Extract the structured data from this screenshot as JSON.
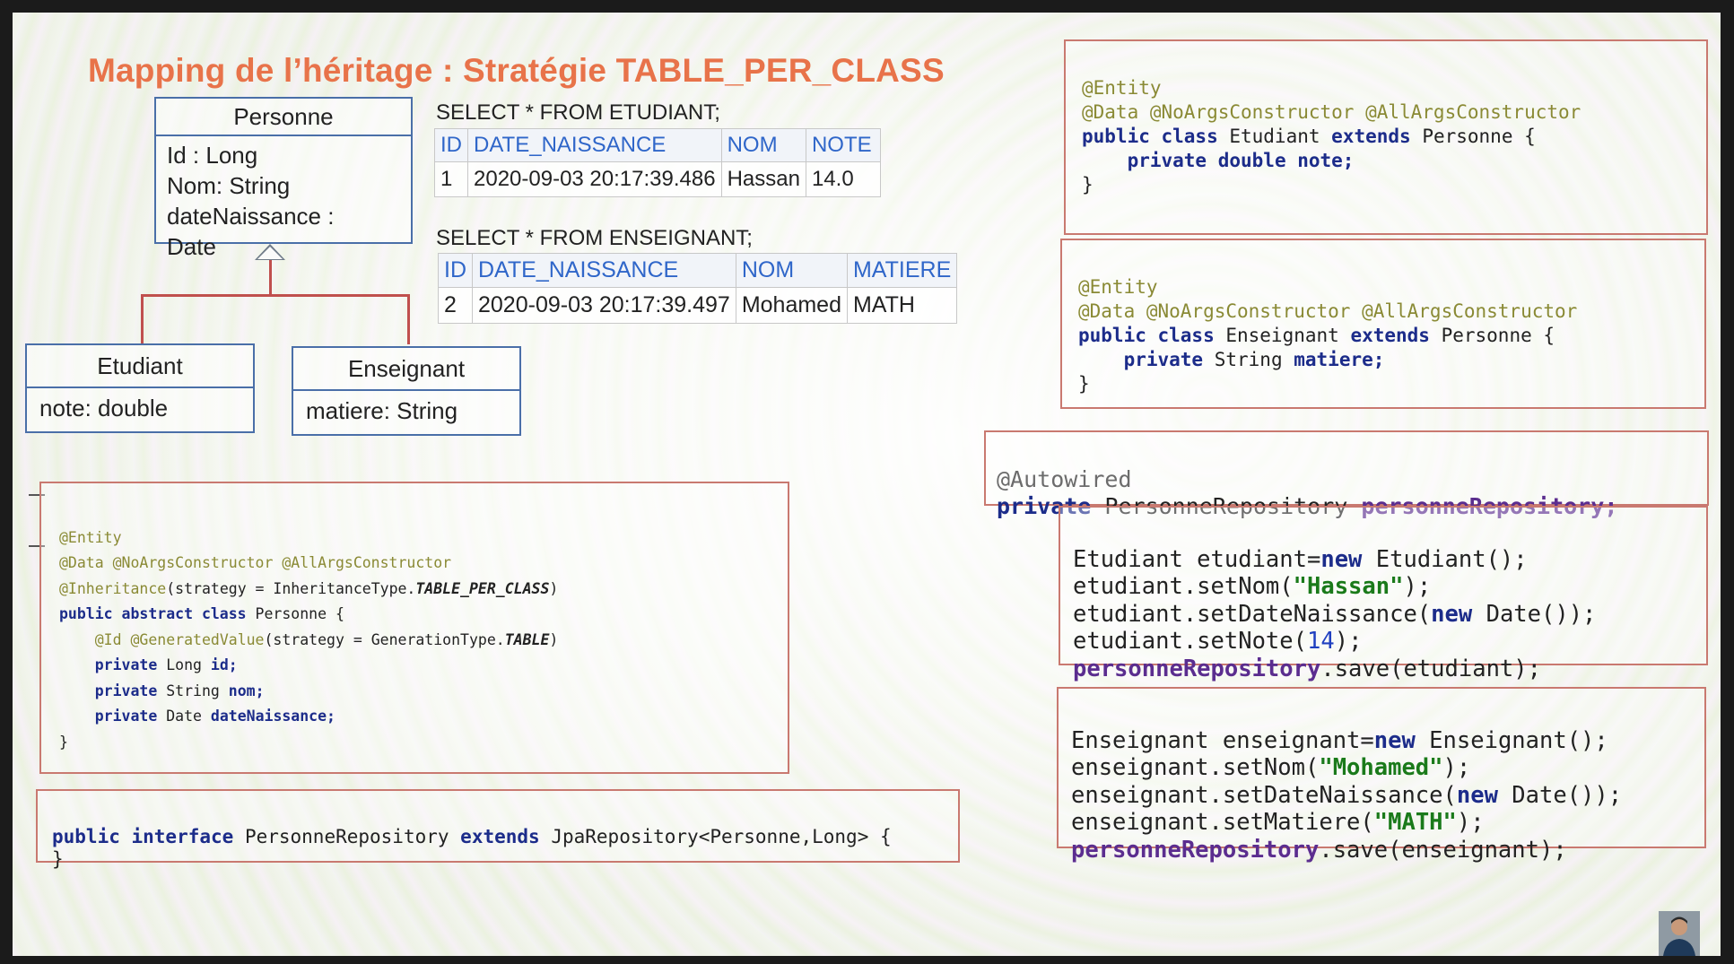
{
  "title": "Mapping de l’héritage : Stratégie TABLE_PER_CLASS",
  "uml": {
    "personne": {
      "name": "Personne",
      "attrs": [
        "Id : Long",
        "Nom: String",
        "dateNaissance :",
        "Date"
      ]
    },
    "etudiant": {
      "name": "Etudiant",
      "attr": "note: double"
    },
    "enseignant": {
      "name": "Enseignant",
      "attr": "matiere: String"
    }
  },
  "sql_etudiant": {
    "query": "SELECT * FROM ETUDIANT;",
    "columns": [
      "ID",
      "DATE_NAISSANCE",
      "NOM",
      "NOTE"
    ],
    "row": [
      "1",
      "2020-09-03 20:17:39.486",
      "Hassan",
      "14.0"
    ]
  },
  "sql_enseignant": {
    "query": "SELECT * FROM ENSEIGNANT;",
    "columns": [
      "ID",
      "DATE_NAISSANCE",
      "NOM",
      "MATIERE"
    ],
    "row": [
      "2",
      "2020-09-03 20:17:39.497",
      "Mohamed",
      "MATH"
    ]
  },
  "code_personne": {
    "l1": "@Entity",
    "l2": "@Data @NoArgsConstructor @AllArgsConstructor",
    "l3_ann": "@Inheritance",
    "l3_a": "(strategy = InheritanceType.",
    "l3_b": "TABLE_PER_CLASS",
    "l3_c": ")",
    "l4_kw": "public abstract class",
    "l4_rest": " Personne {",
    "l5_ann": "@Id @GeneratedValue",
    "l5_a": "(strategy = GenerationType.",
    "l5_b": "TABLE",
    "l5_c": ")",
    "l6_kw": "private",
    "l6_t": " Long ",
    "l6_n": "id;",
    "l7_kw": "private",
    "l7_t": " String ",
    "l7_n": "nom;",
    "l8_kw": "private",
    "l8_t": " Date ",
    "l8_n": "dateNaissance;",
    "l9": "}"
  },
  "code_repo": {
    "kw1": "public interface",
    "a": " PersonneRepository ",
    "kw2": "extends",
    "b": " JpaRepository<Personne,Long> {",
    "close": "}"
  },
  "code_etudiant": {
    "l1": "@Entity",
    "l2": "@Data @NoArgsConstructor @AllArgsConstructor",
    "l3_kw1": "public class",
    "l3_a": " Etudiant ",
    "l3_kw2": "extends",
    "l3_b": " Personne {",
    "l4_kw": "private double",
    "l4_n": " note;",
    "l5": "}"
  },
  "code_enseignant": {
    "l1": "@Entity",
    "l2": "@Data @NoArgsConstructor @AllArgsConstructor",
    "l3_kw1": "public class",
    "l3_a": " Enseignant ",
    "l3_kw2": "extends",
    "l3_b": " Personne {",
    "l4_kw": "private",
    "l4_t": " String ",
    "l4_n": "matiere;",
    "l5": "}"
  },
  "code_autowired": {
    "l1": "@Autowired",
    "kw": "private",
    "t": " PersonneRepository ",
    "n": "personneRepository;"
  },
  "code_save_etudiant": {
    "l1_a": "Etudiant etudiant=",
    "l1_kw": "new",
    "l1_b": " Etudiant();",
    "l2_a": "etudiant.setNom(",
    "l2_s": "\"Hassan\"",
    "l2_b": ");",
    "l3_a": "etudiant.setDateNaissance(",
    "l3_kw": "new",
    "l3_b": " Date());",
    "l4_a": "etudiant.setNote(",
    "l4_n": "14",
    "l4_b": ");",
    "l5_f": "personneRepository",
    "l5_b": ".save(etudiant);"
  },
  "code_save_enseignant": {
    "l1_a": "Enseignant enseignant=",
    "l1_kw": "new",
    "l1_b": " Enseignant();",
    "l2_a": "enseignant.setNom(",
    "l2_s": "\"Mohamed\"",
    "l2_b": ");",
    "l3_a": "enseignant.setDateNaissance(",
    "l3_kw": "new",
    "l3_b": " Date());",
    "l4_a": "enseignant.setMatiere(",
    "l4_s": "\"MATH\"",
    "l4_b": ");",
    "l5_f": "personneRepository",
    "l5_b": ".save(enseignant);"
  },
  "icons": {
    "presenter": "presenter-avatar-icon"
  }
}
